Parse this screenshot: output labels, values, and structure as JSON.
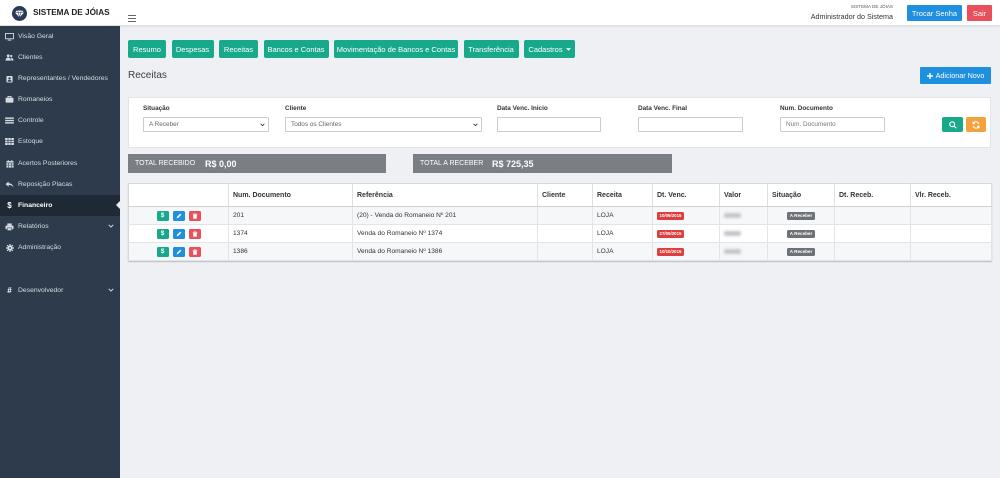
{
  "header": {
    "logo_icon": "gem-logo-icon",
    "app_title": "SISTEMA DE JÓIAS",
    "menu_icon": "hamburger-icon",
    "user_system": "SISTEMA DE JÓIAS",
    "user_name": "Administrador do Sistema",
    "change_password_label": "Trocar Senha",
    "logout_label": "Sair"
  },
  "sidebar": {
    "items": [
      {
        "label": "Visão Geral",
        "icon": "monitor-icon"
      },
      {
        "label": "Clientes",
        "icon": "users-icon"
      },
      {
        "label": "Representantes / Vendedores",
        "icon": "user-badge-icon"
      },
      {
        "label": "Romaneios",
        "icon": "briefcase-icon"
      },
      {
        "label": "Controle",
        "icon": "list-icon"
      },
      {
        "label": "Estoque",
        "icon": "table-icon"
      },
      {
        "label": "Acertos Posteriores",
        "icon": "calendar-icon"
      },
      {
        "label": "Reposição Placas",
        "icon": "reply-icon"
      },
      {
        "label": "Financeiro",
        "icon": "dollar-icon",
        "glyph": "$",
        "active": true
      },
      {
        "label": "Relatórios",
        "icon": "printer-icon",
        "expandable": true
      },
      {
        "label": "Administração",
        "icon": "gear-icon"
      },
      {
        "label": "Desenvolvedor",
        "icon": "hash-icon",
        "glyph": "#",
        "expandable": true
      }
    ]
  },
  "tabs": [
    {
      "label": "Resumo"
    },
    {
      "label": "Despesas"
    },
    {
      "label": "Receitas"
    },
    {
      "label": "Bancos e Contas"
    },
    {
      "label": "Movimentação de Bancos e Contas"
    },
    {
      "label": "Transferência"
    },
    {
      "label": "Cadastros",
      "dropdown": true
    }
  ],
  "page": {
    "title": "Receitas",
    "add_button_label": "Adicionar Novo",
    "add_icon": "plus-icon"
  },
  "filters": {
    "situacao": {
      "label": "Situação",
      "value": "A Receber"
    },
    "cliente": {
      "label": "Cliente",
      "value": "Todos os Clientes"
    },
    "data_inicio": {
      "label": "Data Venc. Inicio"
    },
    "data_final": {
      "label": "Data Venc. Final"
    },
    "num_documento": {
      "label": "Num. Documento",
      "placeholder": "Num. Documento"
    },
    "search_icon": "search-icon",
    "refresh_icon": "refresh-icon"
  },
  "totals": {
    "recebido": {
      "label": "TOTAL RECEBIDO",
      "value": "R$ 0,00"
    },
    "a_receber": {
      "label": "TOTAL A RECEBER",
      "value": "R$ 725,35"
    }
  },
  "table": {
    "columns": [
      "Num. Documento",
      "Referência",
      "Cliente",
      "Receita",
      "Dt. Venc.",
      "Valor",
      "Situação",
      "Dt. Receb.",
      "Vlr. Receb."
    ],
    "action_glyph": "$",
    "rows": [
      {
        "num_documento": "201",
        "referencia": "(20) - Venda do Romaneio Nº 201",
        "receita": "LOJA",
        "dt_venc": "10/09/2015",
        "situacao": "A Receber"
      },
      {
        "num_documento": "1374",
        "referencia": "Venda do Romaneio Nº 1374",
        "receita": "LOJA",
        "dt_venc": "27/09/2015",
        "situacao": "A Receber"
      },
      {
        "num_documento": "1386",
        "referencia": "Venda do Romaneio Nº 1386",
        "receita": "LOJA",
        "dt_venc": "10/10/2015",
        "situacao": "A Receber"
      }
    ]
  },
  "colors": {
    "sidebar_bg": "#2e3b4d",
    "sidebar_active": "#1f2935",
    "tab_green": "#18a98a",
    "primary_blue": "#1f8fe0",
    "danger_red": "#e8505b",
    "warning_orange": "#f3a23b",
    "totals_gray": "#7a7e85",
    "badge_gray": "#6d7277",
    "date_badge_red": "#de3e3e"
  }
}
